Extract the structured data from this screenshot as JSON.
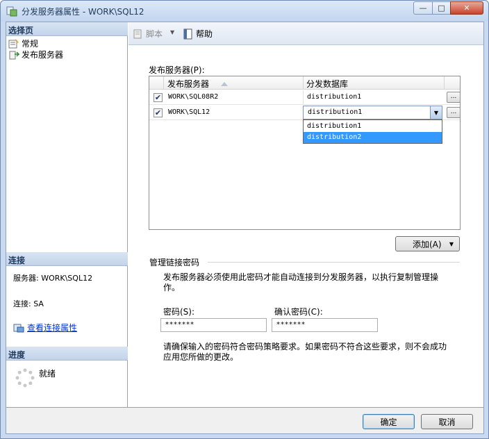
{
  "window": {
    "title": "分发服务器属性 - WORK\\SQL12",
    "min_label": "—",
    "max_label": "□",
    "close_label": "✕"
  },
  "left": {
    "select_page_header": "选择页",
    "pages": [
      {
        "label": "常规",
        "icon": "properties-icon"
      },
      {
        "label": "发布服务器",
        "icon": "publisher-icon"
      }
    ],
    "connection_header": "连接",
    "server_line": "服务器: WORK\\SQL12",
    "connection_line": "连接: SA",
    "view_connection_link": "查看连接属性",
    "progress_header": "进度",
    "progress_status": "就绪"
  },
  "toolbar": {
    "script_label": "脚本",
    "help_label": "帮助"
  },
  "publishers": {
    "group_label": "发布服务器(P):",
    "columns": [
      "发布服务器",
      "分发数据库"
    ],
    "rows": [
      {
        "checked": true,
        "server": "WORK\\SQL08R2",
        "database": "distribution1"
      },
      {
        "checked": true,
        "server": "WORK\\SQL12",
        "database": "distribution1"
      }
    ],
    "ellipsis_label": "...",
    "dropdown_options": [
      "distribution1",
      "distribution2"
    ],
    "dropdown_selected": "distribution2",
    "add_button_label": "添加(A)"
  },
  "password": {
    "group_label": "管理链接密码",
    "description": "发布服务器必须使用此密码才能自动连接到分发服务器，以执行复制管理操作。",
    "password_label": "密码(S):",
    "password_value": "*******",
    "confirm_label": "确认密码(C):",
    "confirm_value": "*******",
    "policy_note": "请确保输入的密码符合密码策略要求。如果密码不符合这些要求，则不会成功应用您所做的更改。"
  },
  "buttons": {
    "ok_label": "确定",
    "cancel_label": "取消"
  },
  "colors": {
    "selection": "#3399ff",
    "link": "#0033cc",
    "section_header_text": "#1e395b"
  }
}
